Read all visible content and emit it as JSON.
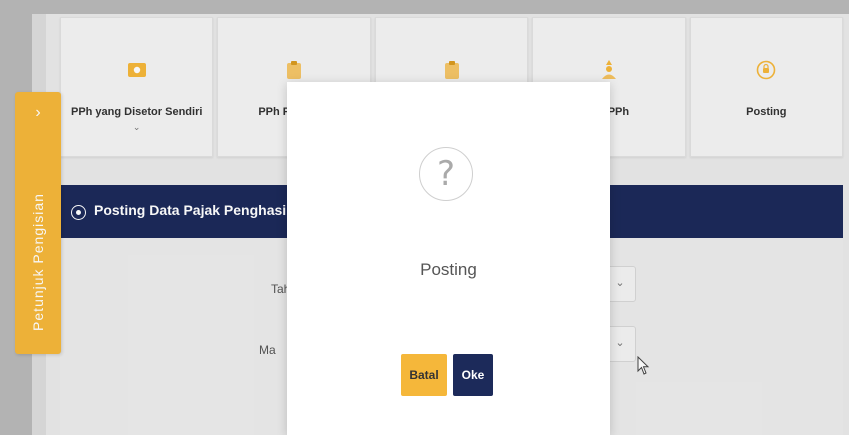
{
  "side_tab": {
    "label": "Petunjuk Pengisian",
    "chevron": "›"
  },
  "steps": [
    {
      "label": "PPh yang Disetor Sendiri",
      "sub": "⌄",
      "icon": "folder-icon",
      "color": "#f5b73a"
    },
    {
      "label": "PPh Pasal 4 a",
      "sub": "",
      "icon": "clipboard-icon",
      "color": "#f5b73a"
    },
    {
      "label": "",
      "sub": "",
      "icon": "clipboard-icon",
      "color": "#f5b73a"
    },
    {
      "label": "ata PPh",
      "sub": "",
      "icon": "user-upload-icon",
      "color": "#f5b73a"
    },
    {
      "label": "Posting",
      "sub": "",
      "icon": "posting-icon",
      "color": "#f5b73a"
    }
  ],
  "section": {
    "title": "Posting Data Pajak Penghasilan"
  },
  "form": {
    "field1_label": "Tah",
    "field2_label": "Ma",
    "select_chevron": "⌄"
  },
  "dialog": {
    "icon": "?",
    "title": "Posting",
    "cancel_label": "Batal",
    "ok_label": "Oke"
  },
  "colors": {
    "accent": "#f5b73a",
    "navy": "#1c2a5a"
  }
}
